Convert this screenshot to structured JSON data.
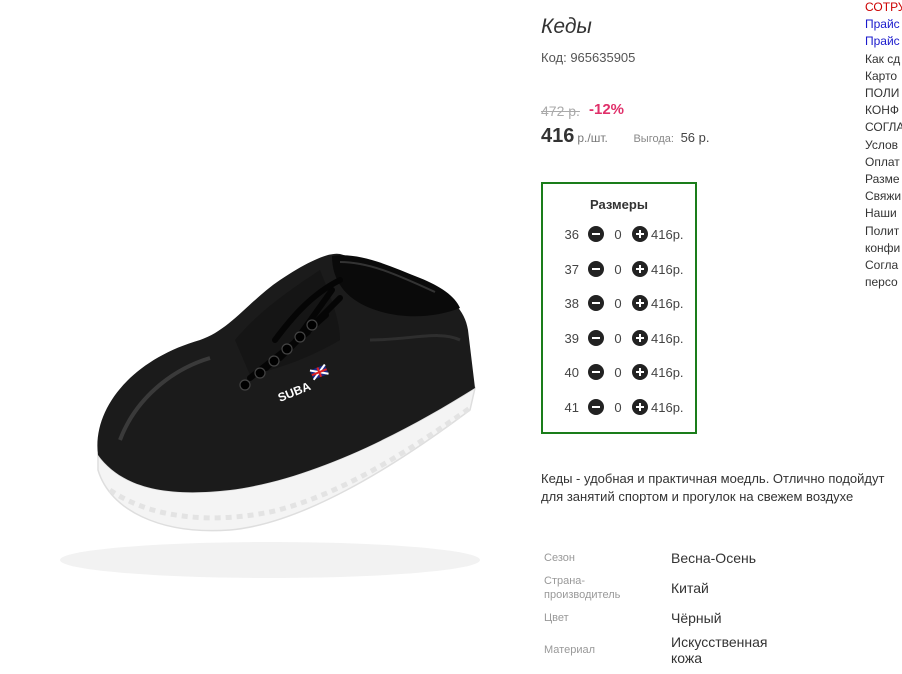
{
  "product": {
    "title": "Кеды",
    "code": "Код: 965635905",
    "old_price": "472 р.",
    "discount": "-12%",
    "price": "416",
    "price_unit": "р./шт.",
    "benefit_label": "Выгода:",
    "benefit_value": "56 р.",
    "image_brand_text": "SUBA"
  },
  "sizes": {
    "title": "Размеры",
    "rows": [
      {
        "size": "36",
        "qty": "0",
        "price": "416р."
      },
      {
        "size": "37",
        "qty": "0",
        "price": "416р."
      },
      {
        "size": "38",
        "qty": "0",
        "price": "416р."
      },
      {
        "size": "39",
        "qty": "0",
        "price": "416р."
      },
      {
        "size": "40",
        "qty": "0",
        "price": "416р."
      },
      {
        "size": "41",
        "qty": "0",
        "price": "416р."
      }
    ]
  },
  "description": "Кеды - удобная и практичная моедль. Отлично подойдут для занятий спортом и прогулок на свежем воздухе",
  "specs": [
    {
      "label": "Сезон",
      "value": "Весна-Осень"
    },
    {
      "label": "Страна-производитель",
      "value": "Китай"
    },
    {
      "label": "Цвет",
      "value": "Чёрный"
    },
    {
      "label": "Материал",
      "value": "Искусственная кожа"
    }
  ],
  "side_menu": [
    "СОТРУ",
    "Прайс",
    "Прайс",
    "Как сд",
    "Карто",
    "ПОЛИ",
    "КОНФ",
    "СОГЛА",
    "Услов",
    "Оплат",
    "Разме",
    "Свяжи",
    "Наши",
    "Полит",
    "конфи",
    "Согла",
    "персо"
  ],
  "colors": {
    "accent_border": "#1a7d1a",
    "discount": "#e0306a",
    "link_red": "#cc0000",
    "link_blue": "#1a1acc"
  }
}
